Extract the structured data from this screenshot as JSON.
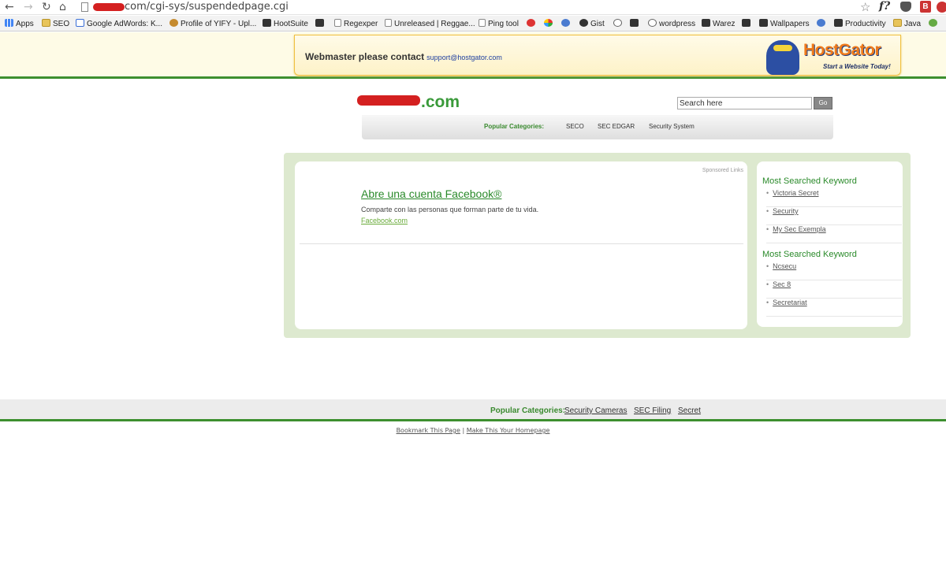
{
  "browser": {
    "url_suffix": "com/cgi-sys/suspendedpage.cgi",
    "bookmarks": [
      {
        "label": "Apps",
        "icon": "apps-grid-icon"
      },
      {
        "label": "SEO",
        "icon": "folder-icon"
      },
      {
        "label": "Google AdWords: K...",
        "icon": "google-icon"
      },
      {
        "label": "Profile of YIFY - Upl...",
        "icon": "profile-shield-icon"
      },
      {
        "label": "HootSuite",
        "icon": "owl-icon"
      },
      {
        "label": "",
        "icon": "dark-square-icon"
      },
      {
        "label": "Regexper",
        "icon": "page-icon"
      },
      {
        "label": "Unreleased | Reggae...",
        "icon": "page-icon"
      },
      {
        "label": "Ping tool",
        "icon": "page-icon"
      },
      {
        "label": "",
        "icon": "red-circle-icon"
      },
      {
        "label": "",
        "icon": "multicolor-icon"
      },
      {
        "label": "",
        "icon": "blue-circle-icon"
      },
      {
        "label": "Gist",
        "icon": "github-icon"
      },
      {
        "label": "",
        "icon": "play-circle-icon"
      },
      {
        "label": "",
        "icon": "fish-icon"
      },
      {
        "label": "wordpress",
        "icon": "wordpress-icon"
      },
      {
        "label": "Warez",
        "icon": "warez-icon"
      },
      {
        "label": "",
        "icon": "b-square-icon"
      },
      {
        "label": "Wallpapers",
        "icon": "bars-icon"
      },
      {
        "label": "",
        "icon": "blue-logo-icon"
      },
      {
        "label": "Productivity",
        "icon": "bars-icon"
      },
      {
        "label": "Java",
        "icon": "folder-icon"
      },
      {
        "label": "",
        "icon": "green-circle-icon"
      }
    ]
  },
  "banner": {
    "contact_text": "Webmaster please contact",
    "email": "support@hostgator.com",
    "logo": "HostGator",
    "tagline": "Start a Website Today!"
  },
  "header": {
    "domain_suffix": ".com",
    "search_placeholder": "Search here",
    "go_label": "Go",
    "categories_label": "Popular Categories:",
    "categories": [
      "SECO",
      "SEC EDGAR",
      "Security System"
    ]
  },
  "ad": {
    "sponsored_label": "Sponsored Links",
    "title": "Abre una cuenta Facebook®",
    "description": "Comparte con las personas que forman parte de tu vida.",
    "url": "Facebook.com"
  },
  "keywords": [
    {
      "heading": "Most Searched Keyword",
      "items": [
        "Victoria Secret",
        "Security",
        "My Sec Exempla"
      ]
    },
    {
      "heading": "Most Searched Keyword",
      "items": [
        "Ncsecu",
        "Sec 8",
        "Secretariat"
      ]
    }
  ],
  "footer": {
    "categories_label": "Popular Categories:",
    "categories": [
      "Security Cameras",
      "SEC Filing",
      "Secret"
    ],
    "bookmark_link": "Bookmark This Page",
    "separator": "|",
    "homepage_link": "Make This Your Homepage"
  }
}
